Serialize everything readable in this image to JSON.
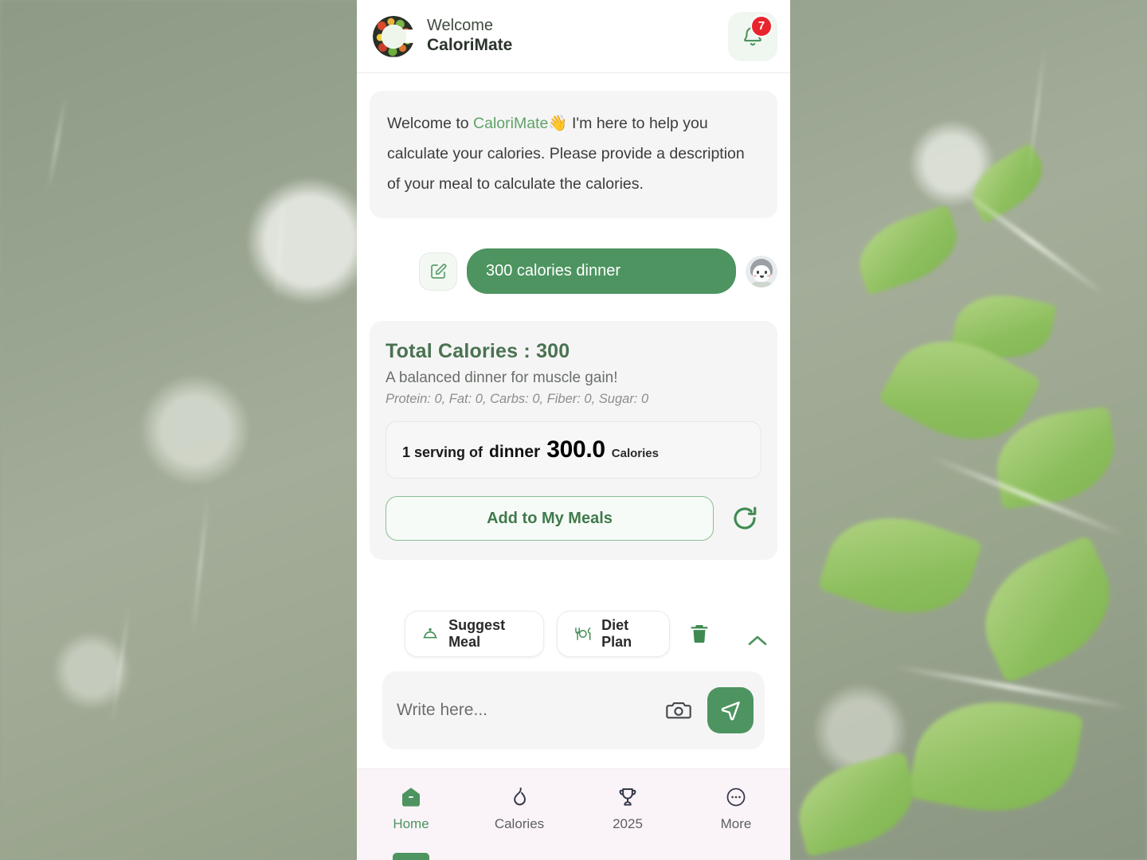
{
  "header": {
    "logo_icon": "calorimate-logo-icon",
    "welcome_label": "Welcome",
    "app_name": "CaloriMate",
    "bell_icon": "bell-icon",
    "notification_count": "7"
  },
  "chat": {
    "bot_message": {
      "prefix": "Welcome to ",
      "brand": "CaloriMate",
      "emoji": "👋",
      "rest": " I'm here to help you calculate your calories. Please provide a description of your meal to calculate the calories."
    },
    "user_message": {
      "edit_icon": "edit-pencil-icon",
      "text": "300 calories dinner",
      "avatar_icon": "user-avatar"
    },
    "result": {
      "total_calories_label": "Total Calories : 300",
      "summary": "A balanced dinner for muscle gain!",
      "macros": "Protein: 0, Fat: 0, Carbs: 0, Fiber: 0, Sugar: 0",
      "serving": {
        "quantity_label": "1 serving of",
        "meal_name": "dinner",
        "calories_value": "300.0",
        "calories_unit": "Calories"
      },
      "add_button_label": "Add to My Meals",
      "refresh_icon": "refresh-icon"
    }
  },
  "quick_actions": [
    {
      "label": "Suggest Meal",
      "icon": "food-cloche-icon"
    },
    {
      "label": "Diet Plan",
      "icon": "plate-cutlery-icon"
    }
  ],
  "quick_action_controls": {
    "delete_icon": "trash-icon",
    "collapse_icon": "chevron-up-icon"
  },
  "composer": {
    "placeholder": "Write here...",
    "value": "",
    "camera_icon": "camera-icon",
    "send_icon": "send-plane-icon"
  },
  "bottom_nav": {
    "items": [
      {
        "label": "Home",
        "icon": "home-icon",
        "active": true
      },
      {
        "label": "Calories",
        "icon": "flame-icon",
        "active": false
      },
      {
        "label": "2025",
        "icon": "trophy-icon",
        "active": false
      },
      {
        "label": "More",
        "icon": "more-dots-icon",
        "active": false
      }
    ]
  },
  "colors": {
    "brand_green": "#4d9460",
    "dark_green": "#4a7251",
    "badge_red": "#e8242c",
    "nav_bg": "#faf4f8"
  }
}
